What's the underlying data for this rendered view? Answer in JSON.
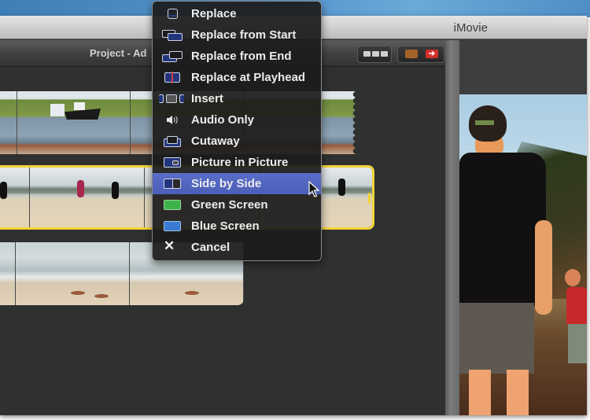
{
  "window": {
    "title": "iMovie"
  },
  "project": {
    "title": "Project - Ad"
  },
  "toolbar": {
    "thumbnail_size_button": "thumbnail-size",
    "comment_marker_button": "comment-marker",
    "chapter_marker_button": "chapter-marker",
    "chapter_marker_glyph": "➔",
    "dropdown_button": "markers-menu"
  },
  "menu": {
    "selected_index": 8,
    "items": [
      {
        "label": "Replace",
        "icon": "replace-icon"
      },
      {
        "label": "Replace from Start",
        "icon": "replace-from-start-icon"
      },
      {
        "label": "Replace from End",
        "icon": "replace-from-end-icon"
      },
      {
        "label": "Replace at Playhead",
        "icon": "replace-at-playhead-icon"
      },
      {
        "label": "Insert",
        "icon": "insert-icon"
      },
      {
        "label": "Audio Only",
        "icon": "speaker-icon"
      },
      {
        "label": "Cutaway",
        "icon": "cutaway-icon"
      },
      {
        "label": "Picture in Picture",
        "icon": "picture-in-picture-icon"
      },
      {
        "label": "Side by Side",
        "icon": "side-by-side-icon"
      },
      {
        "label": "Green Screen",
        "icon": "green-screen-icon"
      },
      {
        "label": "Blue Screen",
        "icon": "blue-screen-icon"
      },
      {
        "label": "Cancel",
        "icon": "close-icon",
        "glyph": "✕"
      }
    ]
  },
  "clips": [
    {
      "name": "boat-harbor-clip",
      "selected": false
    },
    {
      "name": "beach-walk-clip",
      "selected": true
    },
    {
      "name": "beach-waves-clip",
      "selected": false
    }
  ],
  "colors": {
    "selection_yellow": "#f2d338",
    "menu_highlight": "#4b5fb8",
    "green_screen": "#3cb44a",
    "blue_screen": "#3a7ad0"
  }
}
